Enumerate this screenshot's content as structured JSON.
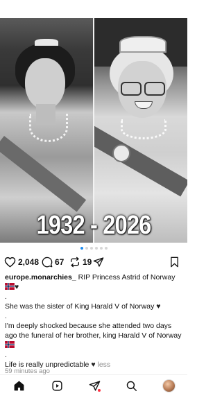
{
  "post": {
    "overlay_text": "1932 - 2026",
    "carousel": {
      "total": 6,
      "active_index": 0
    }
  },
  "actions": {
    "likes": "2,048",
    "comments": "67",
    "reposts": "19"
  },
  "caption": {
    "username": "europe.monarchies_",
    "line1": " RIP Princess Astrid of Norway",
    "dot1": ".",
    "line2": "She was the sister of King Harald V of Norway",
    "dot2": ".",
    "line3": "I'm deeply shocked because she attended two days ago the funeral of her brother, king Harald V of Norway",
    "dot3": ".",
    "line4": "Life is really unpredictable",
    "less_label": "less",
    "timestamp": "59 minutes ago"
  },
  "colors": {
    "accent_dot": "#1d8cf0",
    "notification": "#ff3040",
    "muted_text": "#8e8e8e"
  },
  "icons": {
    "like": "heart-outline-icon",
    "comment": "comment-bubble-icon",
    "repost": "repost-arrows-icon",
    "share": "paper-plane-icon",
    "save": "bookmark-icon",
    "home": "home-icon",
    "reels": "reels-icon",
    "messages": "paper-plane-icon",
    "search": "search-icon"
  }
}
